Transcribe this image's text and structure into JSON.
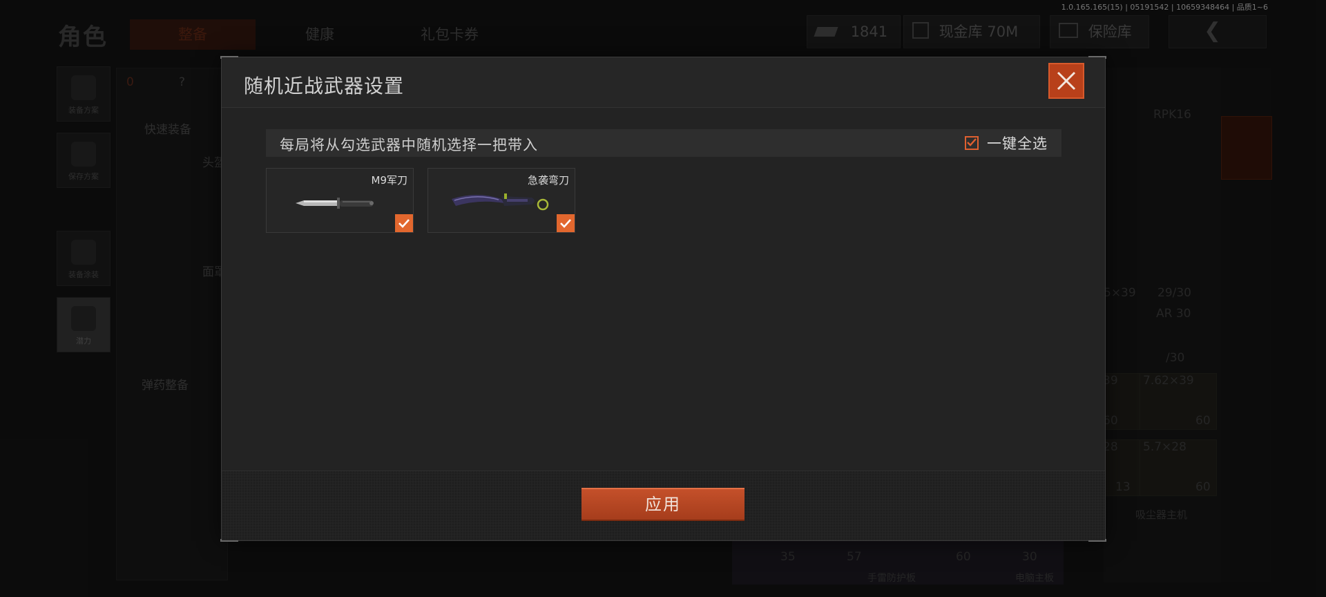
{
  "version_info": "1.0.165.165(15) | 05191542 | 10659348464 | 品质1~6",
  "background": {
    "page_title": "角色",
    "tabs": [
      {
        "label": "整备",
        "active": true
      },
      {
        "label": "健康",
        "active": false
      },
      {
        "label": "礼包卡券",
        "active": false
      }
    ],
    "currency": {
      "value": "1841"
    },
    "cash_vault": {
      "label": "现金库 70M"
    },
    "safe_vault": {
      "label": "保险库"
    },
    "sidebar": [
      {
        "label": "装备方案"
      },
      {
        "label": "保存方案"
      },
      {
        "label": "装备涂装"
      },
      {
        "label": "潜力"
      }
    ],
    "left_panel": {
      "armor_count": "0",
      "help": "?",
      "quick_equip": "快速装备",
      "head": "头盔",
      "face": "面罩",
      "ammo_equip": "弹药整备"
    },
    "right_panel": {
      "rpk": "RPK16",
      "ammo_line1": "5×39",
      "ammo_count1": "29/30",
      "ar": "AR 30",
      "ammo_count2": "/30",
      "ammo_types": [
        "39",
        "7.62×39",
        "28",
        "5.7×28"
      ],
      "ammo_counts": [
        "60",
        "60",
        "13",
        "60"
      ],
      "bottom_counts": [
        "35",
        "57",
        "60",
        "30"
      ],
      "item_label": "吸尘器主机",
      "bottom_labels": [
        "手雷防护板",
        "电脑主板"
      ]
    }
  },
  "modal": {
    "title": "随机近战武器设置",
    "close_icon": "close-icon",
    "info_text": "每局将从勾选武器中随机选择一把带入",
    "select_all": {
      "label": "一键全选",
      "checked": true
    },
    "weapons": [
      {
        "name": "M9军刀",
        "checked": true,
        "icon": "combat-knife-icon"
      },
      {
        "name": "急袭弯刀",
        "checked": true,
        "icon": "karambit-icon"
      }
    ],
    "apply_label": "应用"
  },
  "colors": {
    "accent": "#e2672e",
    "accent_dark": "#a63d1c",
    "panel": "#232323",
    "text": "#cfcfcf"
  }
}
